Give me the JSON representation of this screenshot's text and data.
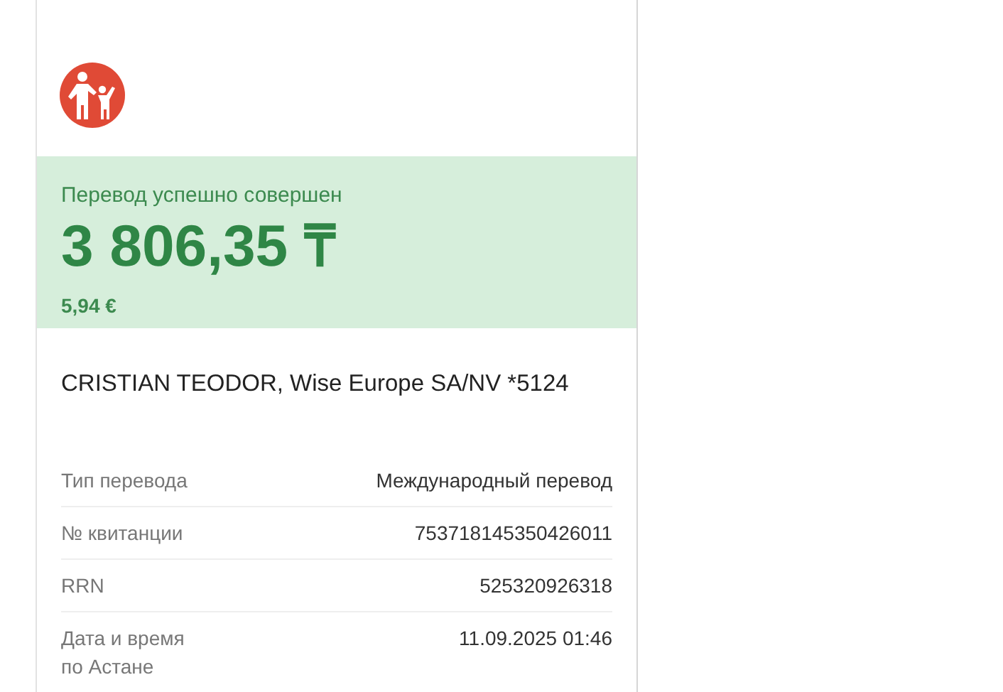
{
  "status": {
    "title": "Перевод успешно совершен",
    "amount": "3 806,35 ₸",
    "converted": "5,94 €"
  },
  "recipient": "CRISTIAN TEODOR, Wise Europe SA/NV *5124",
  "details": [
    {
      "label": "Тип перевода",
      "value": "Международный перевод"
    },
    {
      "label": "№ квитанции",
      "value": "753718145350426011"
    },
    {
      "label": "RRN",
      "value": "525320926318"
    },
    {
      "label": "Дата и время\nпо Астане",
      "value": "11.09.2025 01:46"
    }
  ]
}
